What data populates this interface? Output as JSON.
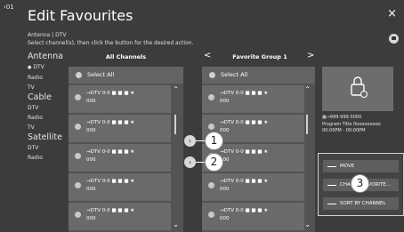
{
  "header": {
    "page_num": "01",
    "title": "Edit Favourites",
    "close_label": "×",
    "sub1": "Antenna | DTV",
    "sub2": "Select channel(s), then click the button for the desired action."
  },
  "sidebar": {
    "groups": [
      {
        "label": "Antenna",
        "items": [
          "DTV",
          "Radio",
          "TV"
        ],
        "selected": "DTV"
      },
      {
        "label": "Cable",
        "items": [
          "DTV",
          "Radio",
          "TV"
        ]
      },
      {
        "label": "Satellite",
        "items": [
          "DTV",
          "Radio"
        ]
      }
    ]
  },
  "left_list": {
    "header": "All Channels",
    "select_all": "Select All",
    "item_line1": "→DTV  0-0  ■ ■ ■ ★",
    "item_line2": "000"
  },
  "right_list": {
    "prev_arrow": "<",
    "header": "Favorite Group 1",
    "next_arrow": ">",
    "select_all": "Select All",
    "item_line1": "→DTV  0-0  ■ ■ ■ ★",
    "item_line2": "000"
  },
  "move_buttons": {
    "add": "›",
    "remove": "‹"
  },
  "preview": {
    "channel": "999-999 0000",
    "program": "Program Title 0ooooooooo",
    "time": "00:00PM - 00:00PM"
  },
  "actions": {
    "move": "MOVE",
    "change": "CHANGE FAVORITE...",
    "sort": "SORT BY CHANNEL"
  },
  "callouts": {
    "c1": "1",
    "c2": "2",
    "c3": "3"
  },
  "colors": {
    "background": "#3c3c3c",
    "pane": "#535353",
    "item": "#6a6a6a"
  }
}
